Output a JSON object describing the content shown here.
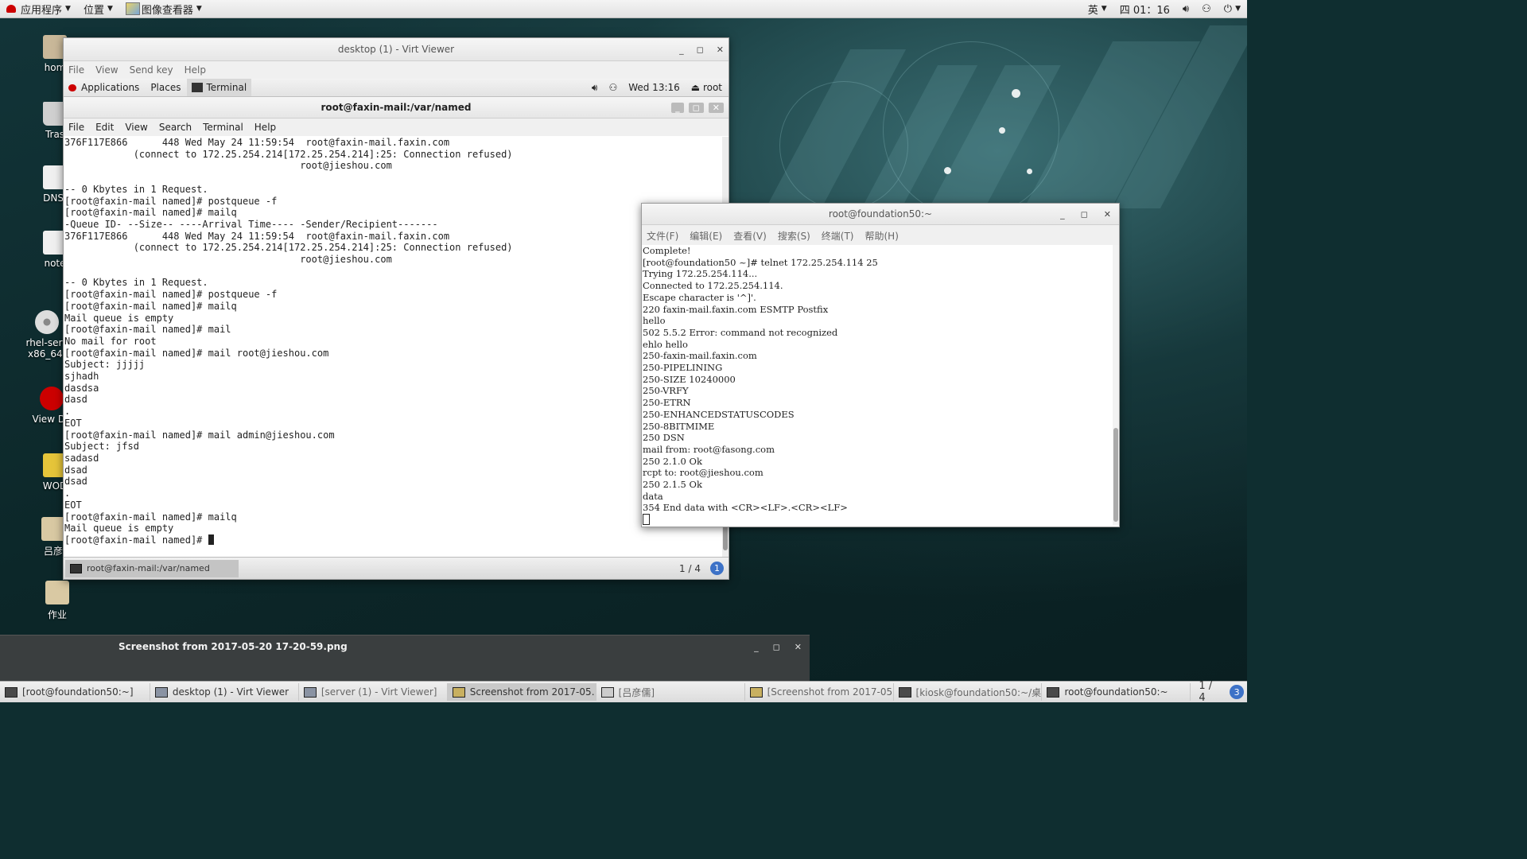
{
  "top_panel": {
    "applications": "应用程序",
    "places": "位置",
    "image_viewer": "图像查看器",
    "input_method": "英",
    "clock": "四 01：16"
  },
  "desktop_icons": [
    {
      "label": "hom"
    },
    {
      "label": "Tras"
    },
    {
      "label": "DNS."
    },
    {
      "label": "note"
    },
    {
      "label": "rhel-serv"
    },
    {
      "label": "x86_64-"
    },
    {
      "label": "View De"
    },
    {
      "label": "WOD"
    },
    {
      "label": "吕彦"
    },
    {
      "label": "作业"
    }
  ],
  "virt_viewer": {
    "title": "desktop (1) - Virt Viewer",
    "menu": [
      "File",
      "View",
      "Send key",
      "Help"
    ]
  },
  "guest_panel": {
    "applications": "Applications",
    "places": "Places",
    "terminal": "Terminal",
    "clock": "Wed 13:16",
    "user": "root"
  },
  "guest_terminal": {
    "title": "root@faxin-mail:/var/named",
    "menu": [
      "File",
      "Edit",
      "View",
      "Search",
      "Terminal",
      "Help"
    ],
    "lines": [
      "376F117E866      448 Wed May 24 11:59:54  root@faxin-mail.faxin.com",
      "            (connect to 172.25.254.214[172.25.254.214]:25: Connection refused)",
      "                                         root@jieshou.com",
      "",
      "-- 0 Kbytes in 1 Request.",
      "[root@faxin-mail named]# postqueue -f",
      "[root@faxin-mail named]# mailq",
      "-Queue ID- --Size-- ----Arrival Time---- -Sender/Recipient-------",
      "376F117E866      448 Wed May 24 11:59:54  root@faxin-mail.faxin.com",
      "            (connect to 172.25.254.214[172.25.254.214]:25: Connection refused)",
      "                                         root@jieshou.com",
      "",
      "-- 0 Kbytes in 1 Request.",
      "[root@faxin-mail named]# postqueue -f",
      "[root@faxin-mail named]# mailq",
      "Mail queue is empty",
      "[root@faxin-mail named]# mail",
      "No mail for root",
      "[root@faxin-mail named]# mail root@jieshou.com",
      "Subject: jjjjj",
      "sjhadh",
      "dasdsa",
      "dasd",
      ".",
      "EOT",
      "[root@faxin-mail named]# mail admin@jieshou.com",
      "Subject: jfsd",
      "sadasd",
      "dsad",
      "dsad",
      ".",
      "EOT",
      "[root@faxin-mail named]# mailq",
      "Mail queue is empty"
    ],
    "prompt": "[root@faxin-mail named]# ",
    "status_tab": "root@faxin-mail:/var/named",
    "workspace": "1 / 4",
    "notify_count": "1"
  },
  "foundation_terminal": {
    "title": "root@foundation50:~",
    "menu": [
      "文件(F)",
      "编辑(E)",
      "查看(V)",
      "搜索(S)",
      "终端(T)",
      "帮助(H)"
    ],
    "lines": [
      "Complete!",
      "[root@foundation50 ~]# telnet 172.25.254.114 25",
      "Trying 172.25.254.114...",
      "Connected to 172.25.254.114.",
      "Escape character is '^]'.",
      "220 faxin-mail.faxin.com ESMTP Postfix",
      "hello",
      "502 5.5.2 Error: command not recognized",
      "ehlo hello",
      "250-faxin-mail.faxin.com",
      "250-PIPELINING",
      "250-SIZE 10240000",
      "250-VRFY",
      "250-ETRN",
      "250-ENHANCEDSTATUSCODES",
      "250-8BITMIME",
      "250 DSN",
      "mail from: root@fasong.com",
      "250 2.1.0 Ok",
      "rcpt to: root@jieshou.com",
      "250 2.1.5 Ok",
      "data",
      "354 End data with <CR><LF>.<CR><LF>"
    ]
  },
  "image_viewer": {
    "title": "Screenshot from 2017-05-20 17-20-59.png"
  },
  "taskbar": {
    "items": [
      "[root@foundation50:~]",
      "desktop (1) - Virt Viewer",
      "[server (1) - Virt Viewer]",
      "Screenshot from 2017-05…",
      "[吕彦儒]",
      "[Screenshot from 2017-05…",
      "[kiosk@foundation50:~/桌面]",
      "root@foundation50:~"
    ],
    "workspace": "1 / 4",
    "notify_count": "3"
  }
}
